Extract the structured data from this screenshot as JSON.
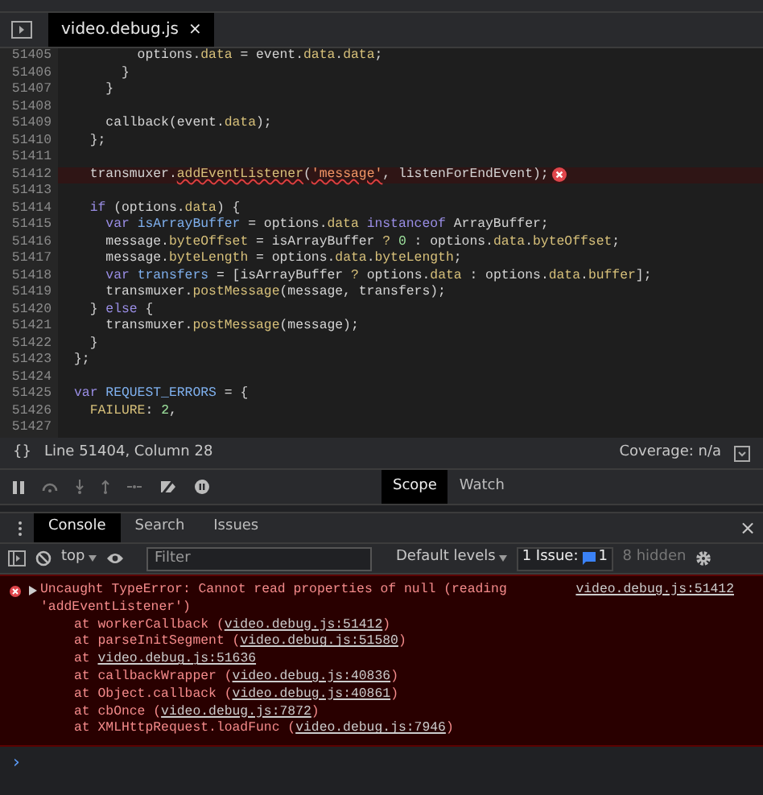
{
  "file_tab": {
    "title": "video.debug.js",
    "close": "×"
  },
  "code_lines": [
    {
      "number": "51405",
      "error": false,
      "tokens": [
        {
          "text": "        options.",
          "kind": "plain"
        },
        {
          "text": "data",
          "kind": "prop"
        },
        {
          "text": " = event.",
          "kind": "plain"
        },
        {
          "text": "data",
          "kind": "prop"
        },
        {
          "text": ".",
          "kind": "plain"
        },
        {
          "text": "data",
          "kind": "prop"
        },
        {
          "text": ";",
          "kind": "plain"
        }
      ]
    },
    {
      "number": "51406",
      "error": false,
      "tokens": [
        {
          "text": "      }",
          "kind": "plain"
        }
      ]
    },
    {
      "number": "51407",
      "error": false,
      "tokens": [
        {
          "text": "    }",
          "kind": "plain"
        }
      ]
    },
    {
      "number": "51408",
      "error": false
    },
    {
      "number": "51409",
      "error": false,
      "tokens": [
        {
          "text": "    callback(event.",
          "kind": "plain"
        },
        {
          "text": "data",
          "kind": "prop"
        },
        {
          "text": ");",
          "kind": "plain"
        }
      ]
    },
    {
      "number": "51410",
      "error": false,
      "tokens": [
        {
          "text": "  };",
          "kind": "plain"
        }
      ]
    },
    {
      "number": "51411",
      "error": false
    },
    {
      "number": "51412",
      "error": true,
      "tokens": [
        {
          "text": "  transmuxer.",
          "kind": "plain"
        },
        {
          "text": "addEventListener",
          "kind": "prop"
        },
        {
          "text": "(",
          "kind": "plain"
        },
        {
          "text": "'message'",
          "kind": "str"
        },
        {
          "text": ", listenForEndEvent);",
          "kind": "plain"
        }
      ]
    },
    {
      "number": "51413",
      "error": false
    },
    {
      "number": "51414",
      "error": false,
      "tokens": [
        {
          "text": "  if",
          "kind": "kw"
        },
        {
          "text": " (options.",
          "kind": "plain"
        },
        {
          "text": "data",
          "kind": "prop"
        },
        {
          "text": ") {",
          "kind": "plain"
        }
      ]
    },
    {
      "number": "51415",
      "error": false,
      "tokens": [
        {
          "text": "    var ",
          "kind": "kw"
        },
        {
          "text": "isArrayBuffer",
          "kind": "def"
        },
        {
          "text": " = options.",
          "kind": "plain"
        },
        {
          "text": "data ",
          "kind": "prop"
        },
        {
          "text": "instanceof",
          "kind": "kw"
        },
        {
          "text": " ArrayBuffer;",
          "kind": "plain"
        }
      ]
    },
    {
      "number": "51416",
      "error": false,
      "tokens": [
        {
          "text": "    message.",
          "kind": "plain"
        },
        {
          "text": "byteOffset",
          "kind": "prop"
        },
        {
          "text": " = isArrayBuffer ",
          "kind": "plain"
        },
        {
          "text": "? ",
          "kind": "prop"
        },
        {
          "text": "0",
          "kind": "num"
        },
        {
          "text": " : options.",
          "kind": "plain"
        },
        {
          "text": "data",
          "kind": "prop"
        },
        {
          "text": ".",
          "kind": "plain"
        },
        {
          "text": "byteOffset",
          "kind": "prop"
        },
        {
          "text": ";",
          "kind": "plain"
        }
      ]
    },
    {
      "number": "51417",
      "error": false,
      "tokens": [
        {
          "text": "    message.",
          "kind": "plain"
        },
        {
          "text": "byteLength",
          "kind": "prop"
        },
        {
          "text": " = options.",
          "kind": "plain"
        },
        {
          "text": "data",
          "kind": "prop"
        },
        {
          "text": ".",
          "kind": "plain"
        },
        {
          "text": "byteLength",
          "kind": "prop"
        },
        {
          "text": ";",
          "kind": "plain"
        }
      ]
    },
    {
      "number": "51418",
      "error": false,
      "tokens": [
        {
          "text": "    var ",
          "kind": "kw"
        },
        {
          "text": "transfers",
          "kind": "def"
        },
        {
          "text": " = [isArrayBuffer ",
          "kind": "plain"
        },
        {
          "text": "?",
          "kind": "prop"
        },
        {
          "text": " options.",
          "kind": "plain"
        },
        {
          "text": "data",
          "kind": "prop"
        },
        {
          "text": " : options.",
          "kind": "plain"
        },
        {
          "text": "data",
          "kind": "prop"
        },
        {
          "text": ".",
          "kind": "plain"
        },
        {
          "text": "buffer",
          "kind": "prop"
        },
        {
          "text": "];",
          "kind": "plain"
        }
      ]
    },
    {
      "number": "51419",
      "error": false,
      "tokens": [
        {
          "text": "    transmuxer.",
          "kind": "plain"
        },
        {
          "text": "postMessage",
          "kind": "prop"
        },
        {
          "text": "(message, transfers);",
          "kind": "plain"
        }
      ]
    },
    {
      "number": "51420",
      "error": false,
      "tokens": [
        {
          "text": "  } ",
          "kind": "plain"
        },
        {
          "text": "else",
          "kind": "kw"
        },
        {
          "text": " {",
          "kind": "plain"
        }
      ]
    },
    {
      "number": "51421",
      "error": false,
      "tokens": [
        {
          "text": "    transmuxer.",
          "kind": "plain"
        },
        {
          "text": "postMessage",
          "kind": "prop"
        },
        {
          "text": "(message);",
          "kind": "plain"
        }
      ]
    },
    {
      "number": "51422",
      "error": false,
      "tokens": [
        {
          "text": "  }",
          "kind": "plain"
        }
      ]
    },
    {
      "number": "51423",
      "error": false,
      "tokens": [
        {
          "text": "};",
          "kind": "plain"
        }
      ]
    },
    {
      "number": "51424",
      "error": false
    },
    {
      "number": "51425",
      "error": false,
      "tokens": [
        {
          "text": "var ",
          "kind": "kw"
        },
        {
          "text": "REQUEST_ERRORS",
          "kind": "def"
        },
        {
          "text": " = {",
          "kind": "plain"
        }
      ]
    },
    {
      "number": "51426",
      "error": false,
      "tokens": [
        {
          "text": "  FAILURE",
          "kind": "prop"
        },
        {
          "text": ": ",
          "kind": "plain"
        },
        {
          "text": "2",
          "kind": "num"
        },
        {
          "text": ",",
          "kind": "plain"
        }
      ]
    },
    {
      "number": "51427",
      "error": false
    }
  ],
  "status_bar": {
    "format": "{}",
    "position": "Line 51404, Column 28",
    "coverage": "Coverage: n/a"
  },
  "sidebar_tabs": [
    {
      "label": "Scope",
      "selected": true
    },
    {
      "label": "Watch",
      "selected": false
    }
  ],
  "drawer_tabs": [
    {
      "label": "Console",
      "selected": true
    },
    {
      "label": "Search",
      "selected": false
    },
    {
      "label": "Issues",
      "selected": false
    }
  ],
  "drawer_close": "×",
  "console_toolbar": {
    "context": "top",
    "filter_placeholder": "Filter",
    "levels": "Default levels",
    "issues_label": "1 Issue:",
    "issues_count": "1",
    "hidden": "8 hidden"
  },
  "error": {
    "message": "Uncaught TypeError: Cannot read properties of null (reading 'addEventListener')",
    "source": "video.debug.js:51412",
    "stack": [
      {
        "before": "at workerCallback (",
        "link": "video.debug.js:51412",
        "after": ")"
      },
      {
        "before": "at parseInitSegment (",
        "link": "video.debug.js:51580",
        "after": ")"
      },
      {
        "before": "at ",
        "link": "video.debug.js:51636"
      },
      {
        "before": "at callbackWrapper (",
        "link": "video.debug.js:40836",
        "after": ")"
      },
      {
        "before": "at Object.callback (",
        "link": "video.debug.js:40861",
        "after": ")"
      },
      {
        "before": "at cbOnce (",
        "link": "video.debug.js:7872",
        "after": ")"
      },
      {
        "before": "at XMLHttpRequest.loadFunc (",
        "link": "video.debug.js:7946",
        "after": ")"
      }
    ]
  },
  "prompt": "›"
}
